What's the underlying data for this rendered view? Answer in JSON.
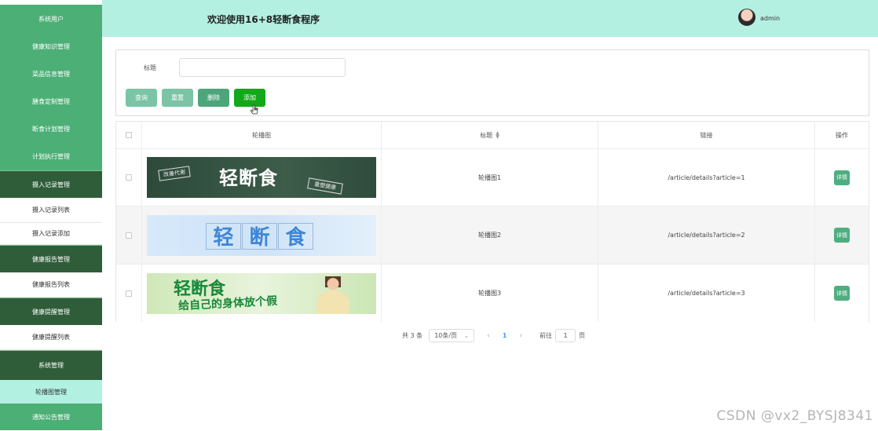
{
  "sidebar": {
    "items": [
      {
        "label": "系统用户"
      },
      {
        "label": "健康知识管理"
      },
      {
        "label": "菜品信息管理"
      },
      {
        "label": "膳食定制管理"
      },
      {
        "label": "断食计划管理"
      },
      {
        "label": "计划执行管理"
      },
      {
        "label": "摄入记录管理"
      },
      {
        "label": "摄入记录列表"
      },
      {
        "label": "摄入记录添加"
      },
      {
        "label": "健康报告管理"
      },
      {
        "label": "健康报告列表"
      },
      {
        "label": "健康提醒管理"
      },
      {
        "label": "健康提醒列表"
      },
      {
        "label": "系统管理"
      },
      {
        "label": "轮播图管理"
      },
      {
        "label": "通知公告管理"
      }
    ]
  },
  "header": {
    "title": "欢迎使用16+8轻断食程序",
    "user": "admin"
  },
  "search": {
    "label": "标题",
    "value": ""
  },
  "buttons": {
    "query": "查询",
    "reset": "重置",
    "delete": "删除",
    "add": "添加"
  },
  "table": {
    "headers": {
      "image": "轮播图",
      "title": "标题",
      "link": "链接",
      "action": "操作"
    },
    "rows": [
      {
        "banner_text": "轻断食",
        "tag1": "改善代谢",
        "tag2": "重塑健康",
        "title": "轮播图1",
        "link": "/article/details?article=1",
        "action": "详情"
      },
      {
        "banner_chars": [
          "轻",
          "断",
          "食"
        ],
        "title": "轮播图2",
        "link": "/article/details?article=2",
        "action": "详情"
      },
      {
        "banner_text": "轻断食",
        "banner_sub": "给自己的身体放个假",
        "title": "轮播图3",
        "link": "/article/details?article=3",
        "action": "详情"
      }
    ]
  },
  "pagination": {
    "total": "共 3 条",
    "page_size": "10条/页",
    "current": "1",
    "goto_prefix": "前往",
    "goto_value": "1",
    "goto_suffix": "页"
  },
  "watermark": "CSDN @vx2_BYSJ8341"
}
